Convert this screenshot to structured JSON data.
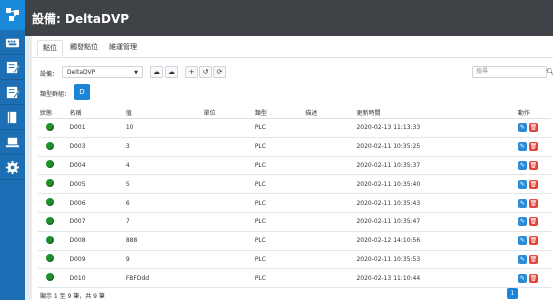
{
  "header": {
    "title": "設備: DeltaDVP"
  },
  "sidebar": {
    "items": [
      "logo",
      "keyboard-icon",
      "edit-icon",
      "edit-icon",
      "book-icon",
      "laptop-icon",
      "gear-icon"
    ]
  },
  "tabs": [
    {
      "label": "點位"
    },
    {
      "label": "觸發點位"
    },
    {
      "label": "維運管理"
    }
  ],
  "toolbar": {
    "device_label": "設備：",
    "device_value": "DeltaDVP",
    "search_placeholder": "搜尋"
  },
  "group": {
    "label": "類型群組：",
    "chip": "D"
  },
  "table": {
    "headers": [
      "狀態",
      "名稱",
      "值",
      "單位",
      "類型",
      "描述",
      "更新時間",
      "動作"
    ],
    "rows": [
      {
        "name": "D001",
        "value": "10",
        "unit": "",
        "type": "PLC",
        "desc": "",
        "time": "2020-02-13 11:13:33"
      },
      {
        "name": "D003",
        "value": "3",
        "unit": "",
        "type": "PLC",
        "desc": "",
        "time": "2020-02-11 10:35:25"
      },
      {
        "name": "D004",
        "value": "4",
        "unit": "",
        "type": "PLC",
        "desc": "",
        "time": "2020-02-11 10:35:37"
      },
      {
        "name": "D005",
        "value": "5",
        "unit": "",
        "type": "PLC",
        "desc": "",
        "time": "2020-02-11 10:35:40"
      },
      {
        "name": "D006",
        "value": "6",
        "unit": "",
        "type": "PLC",
        "desc": "",
        "time": "2020-02-11 10:35:43"
      },
      {
        "name": "D007",
        "value": "7",
        "unit": "",
        "type": "PLC",
        "desc": "",
        "time": "2020-02-11 10:35:47"
      },
      {
        "name": "D008",
        "value": "888",
        "unit": "",
        "type": "PLC",
        "desc": "",
        "time": "2020-02-12 14:10:56"
      },
      {
        "name": "D009",
        "value": "9",
        "unit": "",
        "type": "PLC",
        "desc": "",
        "time": "2020-02-11 10:35:53"
      },
      {
        "name": "D010",
        "value": "FBFDdd",
        "unit": "",
        "type": "PLC",
        "desc": "",
        "time": "2020-02-13 11:10:44"
      }
    ]
  },
  "footer": {
    "summary": "顯示 1 至 9 筆，共 9 筆",
    "page": "1"
  },
  "colors": {
    "sidebar": "#1c6fb5",
    "header": "#3f4347",
    "status_ok": "#1f8f2e",
    "edit": "#2a8bd6",
    "delete": "#e0463a"
  }
}
